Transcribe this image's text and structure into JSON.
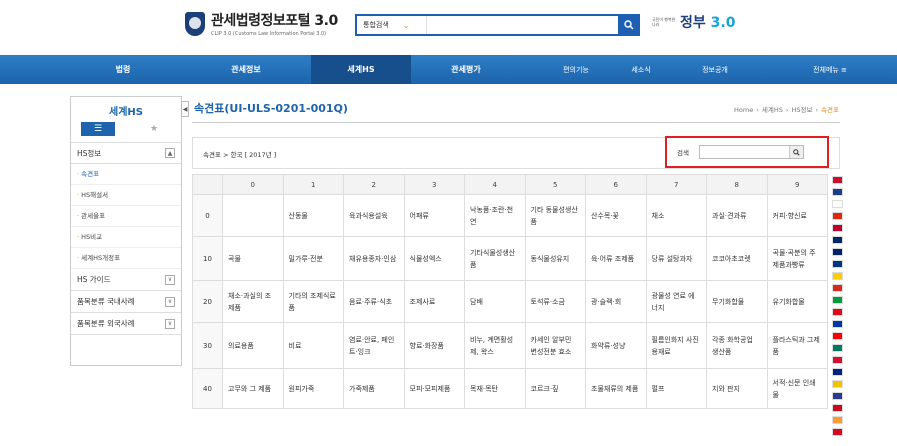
{
  "header": {
    "logo_title": "관세법령정보포털 3.0",
    "logo_sub": "CLIP 3.0 (Customs Law Information Portal 3.0)",
    "search_scope": "통합검색",
    "search_placeholder": "",
    "gov_small": "국민이 행복한 나라",
    "gov_big": "정부",
    "gov_num": "3.0"
  },
  "nav": {
    "items": [
      "법령",
      "관세정보",
      "세계HS",
      "관세평가"
    ],
    "right_items": [
      "편의기능",
      "세소식",
      "정보공개",
      "전체메뉴 ≡"
    ]
  },
  "sidebar": {
    "title": "세계HS",
    "toggle": "◀",
    "tab_list_icon": "list-icon",
    "tab_star_icon": "star-icon",
    "section_hs": "HS정보",
    "section_hs_btn": "▲",
    "sub_items": [
      "속견표",
      "HS해설서",
      "관세율표",
      "HS비교",
      "세계HS개정표"
    ],
    "section_guide": "HS 가이드",
    "section_domestic": "품목분류 국내사례",
    "section_foreign": "품목분류 외국사례",
    "expand_btn": "∨"
  },
  "main": {
    "title": "속견표(UI-ULS-0201-001Q)",
    "breadcrumb": [
      "Home",
      "세계HS",
      "HS정보",
      "속견표"
    ],
    "filter_path": "속견표 > 한국 [ 2017년 ]",
    "search_label": "검색",
    "search_value": ""
  },
  "table": {
    "columns": [
      "",
      "0",
      "1",
      "2",
      "3",
      "4",
      "5",
      "6",
      "7",
      "8",
      "9"
    ],
    "rows": [
      {
        "num": "0",
        "cells": [
          "",
          "산동물",
          "육과식용설육",
          "어패류",
          "낙농품·조란·천연",
          "기타 동물성생산품",
          "산수목·꽃",
          "채소",
          "과실·견과류",
          "커피·향신료"
        ]
      },
      {
        "num": "10",
        "cells": [
          "곡물",
          "밀가루·전분",
          "채유용종자·인삼",
          "식물성엑스",
          "기타식물성생산품",
          "동식물성유지",
          "육·어류 조제품",
          "당류 설탕과자",
          "코코아초코렛",
          "곡물·곡분의 주제품과빵류"
        ]
      },
      {
        "num": "20",
        "cells": [
          "채소·과실의 조제품",
          "기타의 조제식료품",
          "음료·주류·식초",
          "조제사료",
          "담배",
          "토석류·소금",
          "광·슬랙·회",
          "광물성 연료 에너지",
          "무기화합물",
          "유기화합물"
        ]
      },
      {
        "num": "30",
        "cells": [
          "의료용품",
          "비료",
          "염료·안료, 페인트·잉크",
          "향료·화장품",
          "비누, 계면활성제, 왁스",
          "카세인 알부민 변성전분 효소",
          "화약류·성냥",
          "필름인화지 사진용재료",
          "각종 화학공업 생산품",
          "플라스틱과 그제품"
        ]
      },
      {
        "num": "40",
        "cells": [
          "고무와 그 제품",
          "원피가죽",
          "가죽제품",
          "모피·모피제품",
          "목재·목탄",
          "코르크·짚",
          "조물재류의 제품",
          "펄프",
          "지와 판지",
          "서적·신문 인쇄물"
        ]
      }
    ]
  },
  "flags": {
    "colors": [
      "#c8102e",
      "#1b3d8f",
      "#ffffff",
      "#de2910",
      "#bc002d",
      "#002868",
      "#012169",
      "#003580",
      "#ffcc00",
      "#d52b1e",
      "#009c3b",
      "#e30a17",
      "#0038a8",
      "#ff0000",
      "#007a5e",
      "#d21034",
      "#00247d",
      "#f4c300",
      "#2b3990",
      "#c60b1e",
      "#ff9933",
      "#d80621"
    ]
  }
}
